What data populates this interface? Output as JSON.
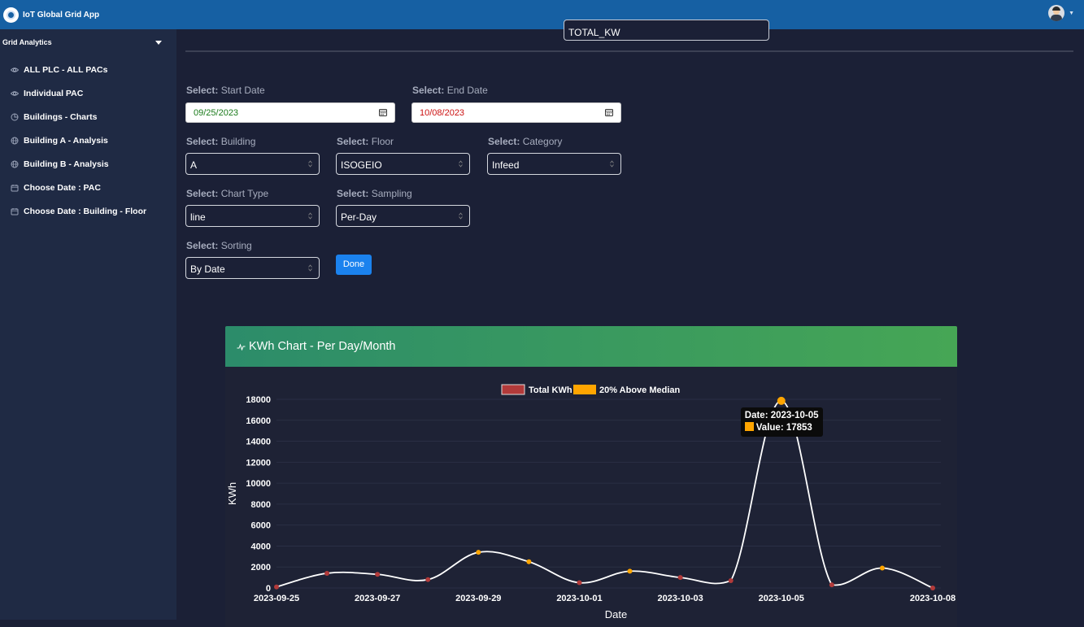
{
  "app": {
    "title": "IoT Global Grid App"
  },
  "sidebar": {
    "header": "Grid Analytics",
    "items": [
      {
        "label": "ALL PLC - ALL PACs",
        "icon": "eye-icon"
      },
      {
        "label": "Individual PAC",
        "icon": "eye-icon"
      },
      {
        "label": "Buildings - Charts",
        "icon": "pie-chart-icon"
      },
      {
        "label": "Building A - Analysis",
        "icon": "globe-icon"
      },
      {
        "label": "Building B - Analysis",
        "icon": "globe-icon"
      },
      {
        "label": "Choose Date : PAC",
        "icon": "calendar-icon"
      },
      {
        "label": "Choose Date : Building - Floor",
        "icon": "calendar-icon"
      }
    ]
  },
  "form": {
    "metric_select": "TOTAL_KW",
    "select_prefix": "Select:",
    "start_date": {
      "label": "Start Date",
      "value": "09/25/2023",
      "color": "#1a7a1a"
    },
    "end_date": {
      "label": "End Date",
      "value": "10/08/2023",
      "color": "#cc1111"
    },
    "building": {
      "label": "Building",
      "value": "A"
    },
    "floor": {
      "label": "Floor",
      "value": "ISOGEIO"
    },
    "category": {
      "label": "Category",
      "value": "Infeed"
    },
    "chart_type": {
      "label": "Chart Type",
      "value": "line"
    },
    "sampling": {
      "label": "Sampling",
      "value": "Per-Day"
    },
    "sorting": {
      "label": "Sorting",
      "value": "By Date"
    },
    "done_label": "Done"
  },
  "chart_card": {
    "title": "KWh Chart - Per Day/Month"
  },
  "tooltip": {
    "line1": "Date: 2023-10-05",
    "line2": "Value: 17853"
  },
  "colors": {
    "total": "#b23a3a",
    "above_median": "#ffa500",
    "line": "#ffffff",
    "navbar": "#1660a3"
  },
  "chart_data": {
    "type": "line",
    "xlabel": "Date",
    "ylabel": "KWh",
    "ylim": [
      0,
      18000
    ],
    "yticks": [
      0,
      2000,
      4000,
      6000,
      8000,
      10000,
      12000,
      14000,
      16000,
      18000
    ],
    "xtick_labels": [
      "2023-09-25",
      "2023-09-27",
      "2023-09-29",
      "2023-10-01",
      "2023-10-03",
      "2023-10-05",
      "2023-10-08"
    ],
    "legend_position": "top",
    "series": [
      {
        "name": "Total KWh"
      },
      {
        "name": "20% Above Median"
      }
    ],
    "points": [
      {
        "date": "2023-09-25",
        "value": 100,
        "above_median": false
      },
      {
        "date": "2023-09-26",
        "value": 1400,
        "above_median": false
      },
      {
        "date": "2023-09-27",
        "value": 1300,
        "above_median": false
      },
      {
        "date": "2023-09-28",
        "value": 800,
        "above_median": false
      },
      {
        "date": "2023-09-29",
        "value": 3400,
        "above_median": true
      },
      {
        "date": "2023-09-30",
        "value": 2500,
        "above_median": true
      },
      {
        "date": "2023-10-01",
        "value": 500,
        "above_median": false
      },
      {
        "date": "2023-10-02",
        "value": 1600,
        "above_median": true
      },
      {
        "date": "2023-10-03",
        "value": 1000,
        "above_median": false
      },
      {
        "date": "2023-10-04",
        "value": 700,
        "above_median": false
      },
      {
        "date": "2023-10-05",
        "value": 17853,
        "above_median": true
      },
      {
        "date": "2023-10-06",
        "value": 300,
        "above_median": false
      },
      {
        "date": "2023-10-07",
        "value": 1900,
        "above_median": true
      },
      {
        "date": "2023-10-08",
        "value": 0,
        "above_median": false
      }
    ]
  }
}
